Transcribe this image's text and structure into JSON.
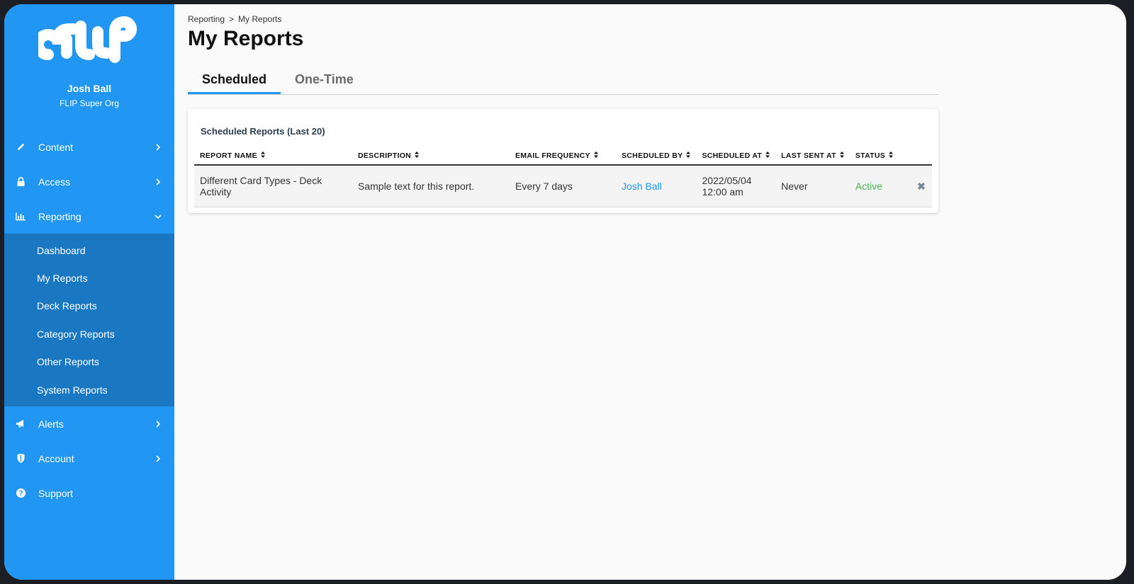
{
  "user": {
    "name": "Josh Ball",
    "org": "FLIP Super Org"
  },
  "nav": {
    "items": [
      {
        "label": "Content",
        "icon": "pencil-icon"
      },
      {
        "label": "Access",
        "icon": "lock-icon"
      },
      {
        "label": "Reporting",
        "icon": "bar-chart-icon"
      },
      {
        "label": "Alerts",
        "icon": "megaphone-icon"
      },
      {
        "label": "Account",
        "icon": "shield-icon"
      },
      {
        "label": "Support",
        "icon": "question-circle-icon"
      }
    ],
    "reporting_sub": [
      "Dashboard",
      "My Reports",
      "Deck Reports",
      "Category Reports",
      "Other Reports",
      "System Reports"
    ]
  },
  "breadcrumb": {
    "parent": "Reporting",
    "separator": ">",
    "current": "My Reports"
  },
  "page_title": "My Reports",
  "tabs": [
    "Scheduled",
    "One-Time"
  ],
  "card": {
    "title": "Scheduled Reports (Last 20)",
    "columns": [
      "REPORT NAME",
      "DESCRIPTION",
      "EMAIL FREQUENCY",
      "SCHEDULED BY",
      "SCHEDULED AT",
      "LAST SENT AT",
      "STATUS"
    ],
    "rows": [
      {
        "report_name": "Different Card Types - Deck Activity",
        "description": "Sample text for this report.",
        "email_frequency": "Every 7 days",
        "scheduled_by": "Josh Ball",
        "scheduled_at_date": "2022/05/04",
        "scheduled_at_time": "12:00 am",
        "last_sent_at": "Never",
        "status": "Active"
      }
    ]
  },
  "colors": {
    "sidebar": "#2196f3",
    "sidebar_sub": "#1a78c2",
    "accent": "#2196f3",
    "status_active": "#4caf50"
  }
}
